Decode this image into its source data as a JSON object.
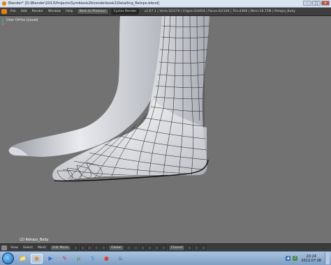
{
  "window": {
    "title": "Blender* [D:\\Blender\\2013\\Projects\\Symbiosis2b\\renderbook2\\Detailing_Retopo.blend]",
    "controls": [
      "–",
      "□",
      "✕"
    ]
  },
  "info_header": {
    "menus": [
      "File",
      "Add",
      "Render",
      "Window",
      "Help"
    ],
    "back_button": "Back to Previous",
    "engine": "Cycles Render",
    "stats": "v2.67.1 | Verts:0/2270 | Edges:0/4454 | Faces:0/2184 | Tris:4368 | Mem:18.75M | Retopo_Body"
  },
  "viewport": {
    "view_label": "User Ortho (Local)",
    "object_label": "(2) Retopo_Body"
  },
  "view3d_header": {
    "menus": [
      "View",
      "Select",
      "Mesh"
    ],
    "mode": "Edit Mode",
    "pivot": "Global",
    "snap": "Closest"
  },
  "taskbar": {
    "apps": [
      {
        "icon": "windows-explorer-icon",
        "glyph": "📁",
        "color": "#e0b040"
      },
      {
        "icon": "blender-icon",
        "glyph": "◉",
        "color": "#e87d0d",
        "active": true
      },
      {
        "icon": "media-player-icon",
        "glyph": "▶",
        "color": "#2f6fd0"
      },
      {
        "icon": "paint-icon",
        "glyph": "✎",
        "color": "#c83c3c"
      },
      {
        "icon": "utorrent-icon",
        "glyph": "µ",
        "color": "#3c9a3c"
      },
      {
        "icon": "skype-icon",
        "glyph": "S",
        "color": "#1a9ee0"
      },
      {
        "icon": "chrome-icon",
        "glyph": "●",
        "color": "#d9442e"
      },
      {
        "icon": "steam-icon",
        "glyph": "♨",
        "color": "#1b2838"
      }
    ],
    "time": "20:24",
    "date": "2013.07.08"
  },
  "colors": {
    "accent": "#e87d0d",
    "viewport_bg": "#727272",
    "header_bg": "#3b3b3b"
  }
}
